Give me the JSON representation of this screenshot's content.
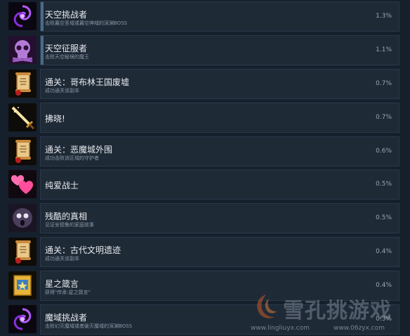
{
  "achievements": [
    {
      "title": "天空挑战者",
      "desc": "击败暮空圣域或暮空神域的深渊BOSS",
      "percent": "1.3%",
      "icon": "purple-swirl-icon"
    },
    {
      "title": "天空征服者",
      "desc": "击败天空秘境的魔王",
      "percent": "1.1%",
      "icon": "purple-skull-icon"
    },
    {
      "title": "通关：哥布林王国废墟",
      "desc": "成功通关该副本",
      "percent": "0.7%",
      "icon": "scroll-icon"
    },
    {
      "title": "拂晓!",
      "desc": "",
      "percent": "0.7%",
      "icon": "golden-sword-icon"
    },
    {
      "title": "通关：恶魔城外围",
      "desc": "成功击败该区域的守护者",
      "percent": "0.6%",
      "icon": "scroll-icon"
    },
    {
      "title": "纯爱战士",
      "desc": "",
      "percent": "0.5%",
      "icon": "pink-hearts-icon"
    },
    {
      "title": "残酷的真相",
      "desc": "见证安德鲁的家庭故事",
      "percent": "0.5%",
      "icon": "shadow-face-icon"
    },
    {
      "title": "通关：古代文明遗迹",
      "desc": "成功通关该副本",
      "percent": "0.4%",
      "icon": "scroll-icon"
    },
    {
      "title": "星之箴言",
      "desc": "获得\"传承:星之箴言\"",
      "percent": "0.4%",
      "icon": "gold-tome-icon"
    },
    {
      "title": "魔域挑战者",
      "desc": "击败幻灭魔域或者破灭魔域的深渊BOSS",
      "percent": "0.3%",
      "icon": "purple-swirl-icon"
    }
  ],
  "watermark": {
    "brand": "雪孔挑游戏",
    "url_left": "www.lingliuyx.com",
    "url_right": "www.06zyx.com"
  },
  "colors": {
    "background": "#16202d",
    "panel": "#1f2a37",
    "accent_bar": "#4a6b8a"
  }
}
